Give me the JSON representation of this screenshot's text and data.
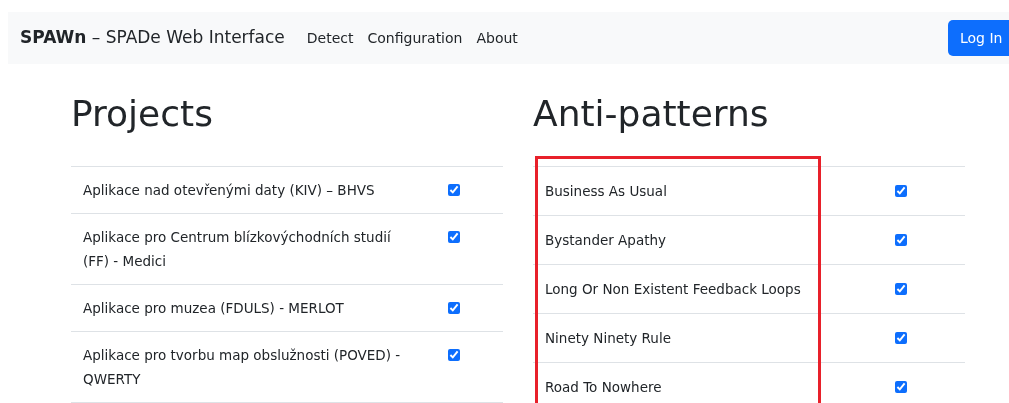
{
  "navbar": {
    "brand_bold": "SPAWn",
    "brand_rest": "– SPADe Web Interface",
    "links": [
      "Detect",
      "Configuration",
      "About"
    ],
    "login_button": "Log In"
  },
  "sections": [
    {
      "heading": "Projects",
      "highlighted": false,
      "rows": [
        {
          "label": "Aplikace nad otevřenými daty (KIV) – BHVS",
          "checked": true
        },
        {
          "label": "Aplikace pro Centrum blízkovýchodních studií (FF) - Medici",
          "checked": true
        },
        {
          "label": "Aplikace pro muzea (FDULS) - MERLOT",
          "checked": true
        },
        {
          "label": "Aplikace pro tvorbu map obslužnosti (POVED) - QWERTY",
          "checked": true
        }
      ]
    },
    {
      "heading": "Anti-patterns",
      "highlighted": true,
      "rows": [
        {
          "label": "Business As Usual",
          "checked": true
        },
        {
          "label": "Bystander Apathy",
          "checked": true
        },
        {
          "label": "Long Or Non Existent Feedback Loops",
          "checked": true
        },
        {
          "label": "Ninety Ninety Rule",
          "checked": true
        },
        {
          "label": "Road To Nowhere",
          "checked": true
        }
      ]
    }
  ]
}
